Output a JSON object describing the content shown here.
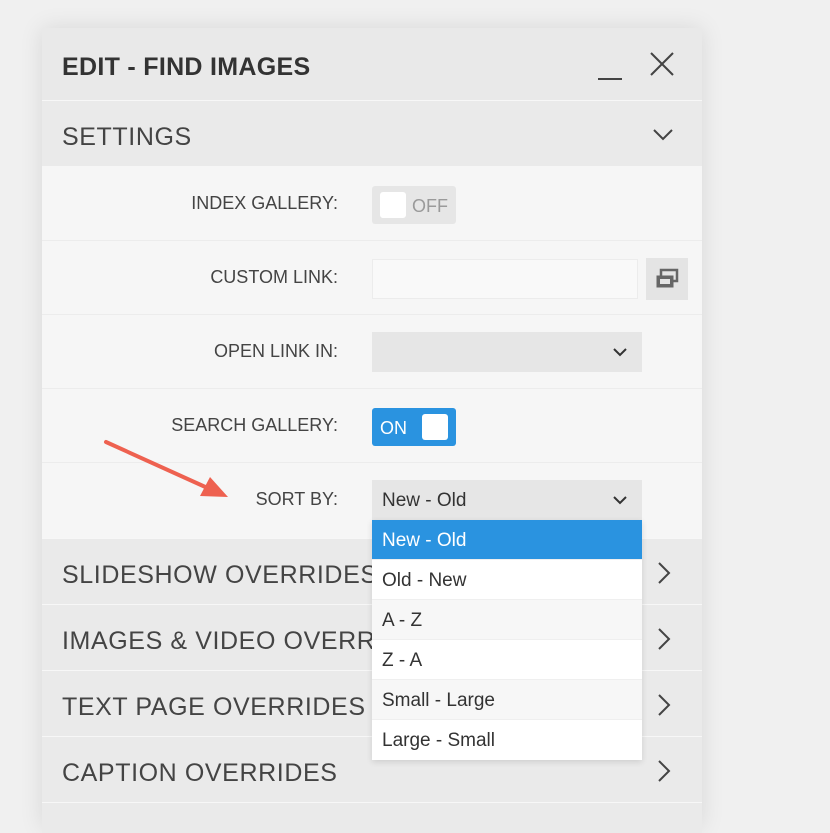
{
  "window": {
    "title": "EDIT - FIND IMAGES"
  },
  "sections": {
    "settings": "SETTINGS",
    "slideshow": "SLIDESHOW OVERRIDES",
    "images_video": "IMAGES & VIDEO OVERRIDES",
    "text_page": "TEXT PAGE OVERRIDES",
    "caption": "CAPTION OVERRIDES"
  },
  "settings": {
    "index_gallery": {
      "label": "INDEX GALLERY:",
      "state": "OFF"
    },
    "custom_link": {
      "label": "CUSTOM LINK:",
      "value": ""
    },
    "open_link_in": {
      "label": "OPEN LINK IN:",
      "value": ""
    },
    "search_gallery": {
      "label": "SEARCH GALLERY:",
      "state": "ON"
    },
    "sort_by": {
      "label": "SORT BY:",
      "value": "New - Old",
      "options": [
        "New - Old",
        "Old - New",
        "A - Z",
        "Z - A",
        "Small - Large",
        "Large - Small"
      ],
      "selected_index": 0
    }
  },
  "colors": {
    "accent": "#2a93e0",
    "arrow": "#ee6150"
  },
  "icons": {
    "minimize": "minimize-icon",
    "close": "close-icon",
    "chevron_down": "chevron-down-icon",
    "chevron_right": "chevron-right-icon",
    "link_browse": "link-browse-icon",
    "arrow": "annotation-arrow-icon"
  }
}
